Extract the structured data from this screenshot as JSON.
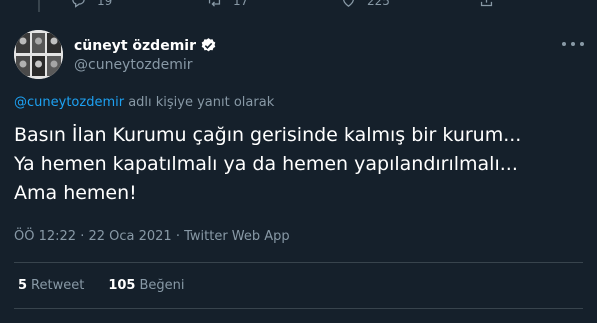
{
  "previous_tweet_actions": {
    "reply_count": "19",
    "retweet_count": "17",
    "like_count": "225"
  },
  "tweet": {
    "author_name": "cüneyt özdemir",
    "author_handle": "@cuneytozdemir",
    "verified": true,
    "reply_to": {
      "mention": "@cuneytozdemir",
      "suffix": " adlı kişiye yanıt olarak"
    },
    "text_lines": [
      "Basın İlan Kurumu çağın gerisinde kalmış bir kurum...",
      "Ya hemen kapatılmalı ya da hemen yapılandırılmalı...",
      "Ama hemen!"
    ],
    "timestamp": "ÖÖ 12:22 · 22 Oca 2021 · Twitter Web App",
    "retweets": {
      "count": "5",
      "label": "Retweet"
    },
    "likes": {
      "count": "105",
      "label": "Beğeni"
    }
  },
  "colors": {
    "background": "#15202b",
    "text": "#ffffff",
    "secondary": "#8899a6",
    "accent": "#1da1f2",
    "border": "#38444d"
  }
}
